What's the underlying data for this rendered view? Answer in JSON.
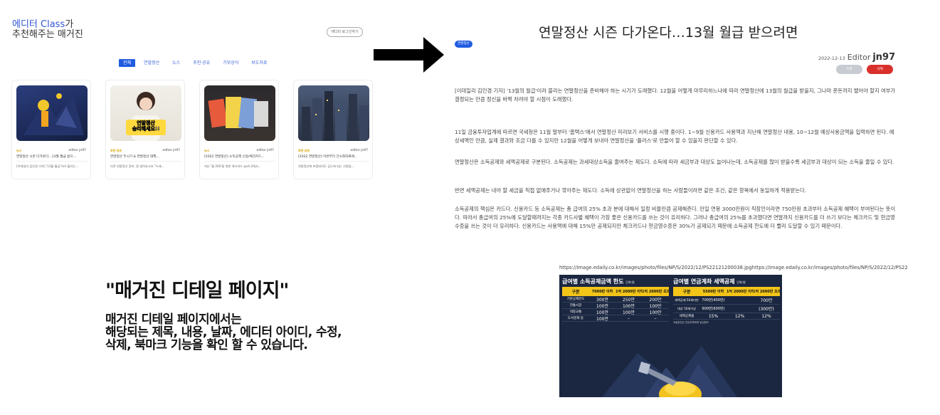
{
  "left_page": {
    "header_line1_highlight": "에디터 Class",
    "header_line1_rest": "가",
    "header_line2": "추천해주는 매거진",
    "login_button": "에디터 로그인하기",
    "tabs": [
      "전체",
      "연말정산",
      "뉴스",
      "추천·공유",
      "기부상식",
      "보도자료"
    ],
    "active_tab": 0,
    "cards": [
      {
        "category": "뉴스",
        "author": "editor jn97",
        "title": "연말정산 시즌 다가온다…13월 월급 받으...",
        "summary": "[이데일리 김인경 기자] '13월 월급'이라 불리는..."
      },
      {
        "category": "추천·공유",
        "author": "editor jn97",
        "title": "연말정산 뚜시기 & 연말정산 대책...",
        "summary": "다른 연말정산 정보, 잘 살아요고요 \"드래..."
      },
      {
        "category": "뉴스",
        "author": "editor jn97",
        "title": "[2022 연말정산] 소득공제 신용/체크카드...",
        "summary": "지난 '월 200'을 위한 체크카드 part.2에서..."
      },
      {
        "category": "추천·공유",
        "author": "editor jn97",
        "title": "[2022 연말정산] 이번부터 간소화자료에...",
        "summary": "연말정산에 포함되어도 감소에 되는 사항들..."
      }
    ],
    "card2_overlay": "연말정산\n승리해세요!!"
  },
  "caption": {
    "title": "\"매거진 디테일 페이지\"",
    "body": [
      "매거진 디테일 페이지에서는",
      "해당되는 제목, 내용, 날짜, 에디터 아이디, 수정,",
      "삭제, 북마크 기능을 확인 할 수 있습니다."
    ]
  },
  "detail": {
    "title": "연말정산 시즌 다가온다…13월 월급 받으려면",
    "category_badge": "연말정산",
    "date": "2022-12-13",
    "editor_label": "Editor",
    "editor_id": "jn97",
    "edit_button": "수정",
    "delete_button": "삭제",
    "paragraphs": [
      "[이데일리 김인경 기자] '13월의 월급'이라 불리는 연말정산을 준비해야 하는 시기가 도래했다. 12월을 어떻게 마무리하느냐에 따라 연말정산에 13월의 월급을 받을지, 그나마 푼돈까지 뱉어야 할지 여부가 결정되는 만큼 정신을 바짝 차려야 할 시점이 도래했다.",
      "11일 금융투자업계에 따르면 국세청은 11월 말부터 '홈택스'에서 연말정산 미리보기 서비스를 시행 중이다. 1~9월 신용카드 사용액과 지난해 연말정산 내용, 10~12월 예상사용금액을 입력하면 된다. 예상세액인 만큼, 실제 결과와 조금 다를 수 있지만 12월을 어떻게 보내야 연말정산을 '플러스'로 만들어 할 수 있을지 판단할 수 있다.",
      "연말정산은 소득공제와 세액공제로 구분된다. 소득공제는 과세대상소득을 줄여주는 제도다. 소득에 따라 세금부과 대상도 늘어나는데, 소득공제를 많이 받을수록 세금부과 대상이 되는 소득을 줄일 수 있다.",
      "반면 세액공제는 내야 할 세금을 직접 없애주거나 깎아주는 제도다. 소득에 상관없이 연말정산을 하는 사람들이라면 같은 조건, 같은 항목에서 동일하게 적용받는다.",
      "소득공제의 핵심은 카드다. 신용카드 등 소득공제는 총 급여의 25% 초과 분에 대해서 일정 비율만큼 공제해준다. 만일 연봉 3000만원이 직장인이라면 750만원 초과부터 소득공제 혜택이 부여된다는 뜻이다. 따라서 총급여의 25%에 도달할때까지는 각종 카드사별 혜택이 가장 좋은 신용카드를 쓰는 것이 유리하다. 그러나 총급여의 25%를 초과했다면 연말까지 신용카드를 더 쓰기 보다는 체크카드 및 현금영수증을 쓰는 것이 더 유리하다. 신용카드는 사용액에 대해 15%만 공제되지만 체크카드나 현금영수증은 30%가 공제되기 때문에 소득공제 한도에 더 빨리 도달할 수 있기 때문이다."
    ],
    "image_url": "https://image.edaily.co.kr/images/photo/files/NP/S/2022/12/PS22121200038.jpghttps://image.edaily.co.kr/images/photo/files/NP/S/2022/12/PS2212120",
    "infographic": {
      "left_title": "급여별 소득공제금액 한도",
      "left_unit": "단위:원",
      "left_head": [
        "구분",
        "7000만 이하",
        "1억 2000만 이하",
        "1억 2000만 초과"
      ],
      "left_rows": [
        [
          "기본공제한도",
          "300만",
          "250만",
          "200만"
        ],
        [
          "전통시장",
          "100만",
          "100만",
          "100만"
        ],
        [
          "대중교통",
          "100만",
          "100만",
          "100만"
        ],
        [
          "도서문화 등",
          "100만",
          "–",
          "–"
        ]
      ],
      "right_title": "급여별 연금계좌 세액공제",
      "right_unit": "단위:원",
      "right_head": [
        "구분",
        "5500만 이하",
        "1억 2000만 이하",
        "1억 2000만 초과"
      ],
      "right_rows": [
        [
          "세액공제 50세미만",
          "700만(400만)",
          "",
          "700만"
        ],
        [
          "대상 50세이상",
          "900만(600만)",
          "",
          "(300만)"
        ],
        [
          "세액공제율",
          "15%",
          "12%",
          "12%"
        ]
      ],
      "footnote": "※괄호안은 연금저축계좌 납입한도"
    }
  }
}
